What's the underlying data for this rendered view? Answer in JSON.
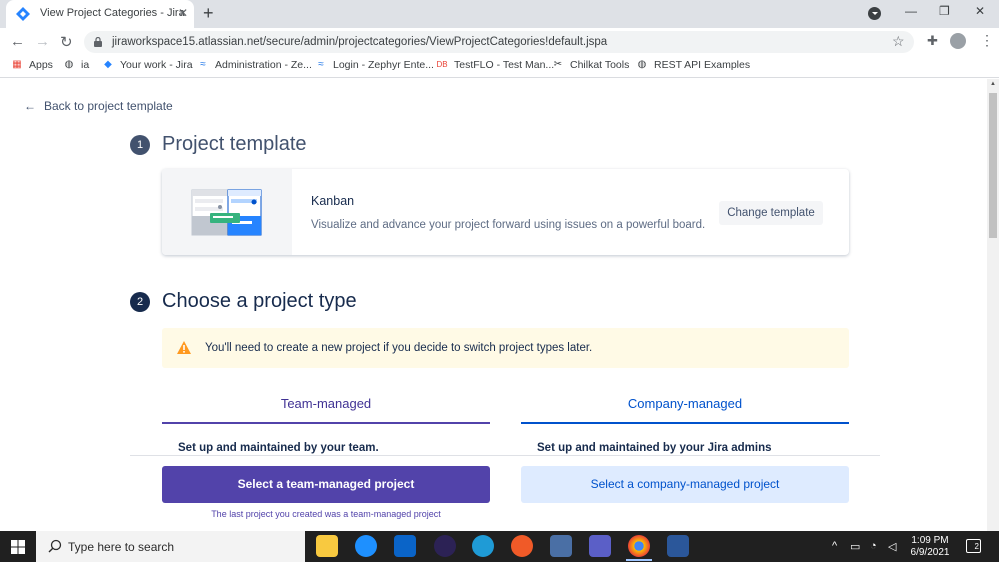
{
  "browser": {
    "tab_title": "View Project Categories - Jira",
    "url": "jiraworkspace15.atlassian.net/secure/admin/projectcategories/ViewProjectCategories!default.jspa",
    "bookmarks": [
      {
        "label": "Apps",
        "icon": "apps-grid-icon"
      },
      {
        "label": "ia",
        "icon": "globe-icon"
      },
      {
        "label": "Your work - Jira",
        "icon": "jira-icon"
      },
      {
        "label": "Administration - Ze...",
        "icon": "zephyr-icon"
      },
      {
        "label": "Login - Zephyr Ente...",
        "icon": "zephyr-icon"
      },
      {
        "label": "TestFLO - Test Man...",
        "icon": "testflo-icon"
      },
      {
        "label": "Chilkat Tools",
        "icon": "chilkat-icon"
      },
      {
        "label": "REST API Examples",
        "icon": "globe-icon"
      }
    ]
  },
  "page": {
    "back_link": "Back to project template",
    "step1": {
      "number": "1",
      "title": "Project template"
    },
    "template": {
      "name": "Kanban",
      "description": "Visualize and advance your project forward using issues on a powerful board.",
      "change_button": "Change template"
    },
    "step2": {
      "number": "2",
      "title": "Choose a project type"
    },
    "warning": "You'll need to create a new project if you decide to switch project types later.",
    "types": {
      "team": {
        "tab": "Team-managed",
        "subheading": "Set up and maintained by your team.",
        "button": "Select a team-managed project",
        "note": "The last project you created was a team-managed project"
      },
      "company": {
        "tab": "Company-managed",
        "subheading": "Set up and maintained by your Jira admins",
        "button": "Select a company-managed project"
      }
    }
  },
  "taskbar": {
    "search_placeholder": "Type here to search",
    "time": "1:09 PM",
    "date": "6/9/2021",
    "notification_count": "2"
  },
  "colors": {
    "team_purple": "#5243aa",
    "company_blue": "#0052cc",
    "warning_bg": "#fffae6",
    "step_badge": "#42526e"
  }
}
